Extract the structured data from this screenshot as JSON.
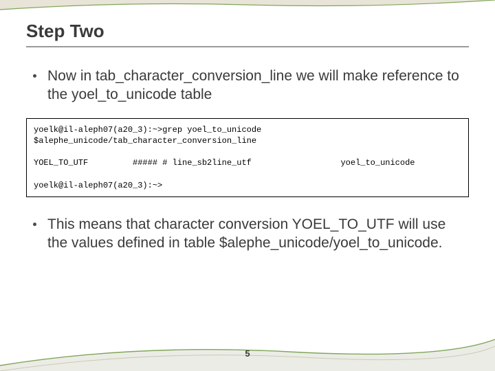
{
  "title": "Step Two",
  "bullets": [
    "Now in tab_character_conversion_line we will make reference to the yoel_to_unicode table",
    "This means that character conversion YOEL_TO_UTF will use the values defined in table $alephe_unicode/yoel_to_unicode."
  ],
  "code": "yoelk@il-aleph07(a20_3):~>grep yoel_to_unicode\n$alephe_unicode/tab_character_conversion_line\n\nYOEL_TO_UTF         ##### # line_sb2line_utf                  yoel_to_unicode\n\nyoelk@il-aleph07(a20_3):~>",
  "page_number": "5"
}
